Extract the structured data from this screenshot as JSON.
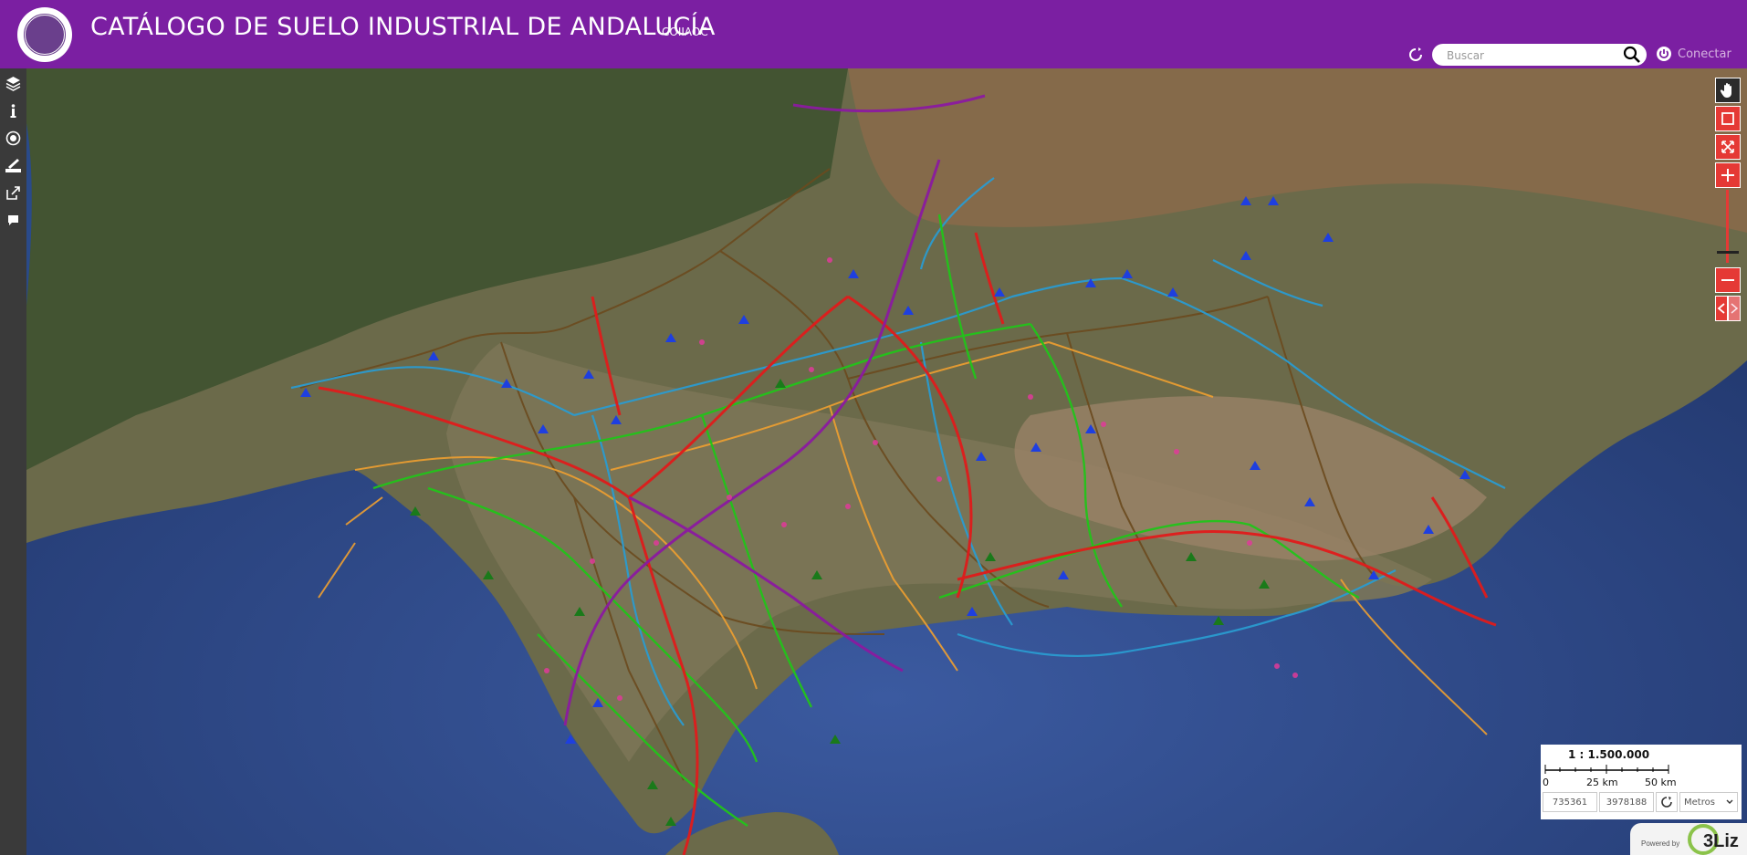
{
  "header": {
    "title": "CATÁLOGO DE SUELO INDUSTRIAL DE ANDALUCÍA",
    "subtitle": "COIIAOC",
    "search_placeholder": "Buscar",
    "connect_label": "Conectar",
    "bg_color": "#7b1fa2"
  },
  "left_toolbar": {
    "items": [
      "layers-icon",
      "info-icon",
      "locate-icon",
      "measure-icon",
      "share-icon",
      "comment-icon"
    ]
  },
  "map_controls": {
    "items": [
      "pan-icon",
      "zoom-box-icon",
      "fullscreen-icon",
      "zoom-in-icon",
      "zoom-out-icon",
      "previous-view-icon"
    ],
    "accent_color": "#e53935"
  },
  "scale": {
    "ratio": "1 : 1.500.000",
    "ticks": [
      "0",
      "25 km",
      "50 km"
    ],
    "coord_x": "735361",
    "coord_y": "3978188",
    "units": "Metros"
  },
  "footer": {
    "powered_by": "Powered by",
    "brand": "3Liz"
  },
  "map_legend_colors": {
    "highways": "#e01b1b",
    "railways": "#22c41a",
    "gas": "#8b1aa0",
    "power_lines": "#2a9bd0",
    "roads": "#f0a030",
    "boundaries": "#6b4a1e",
    "industrial_sites": "#1e3fe0"
  }
}
